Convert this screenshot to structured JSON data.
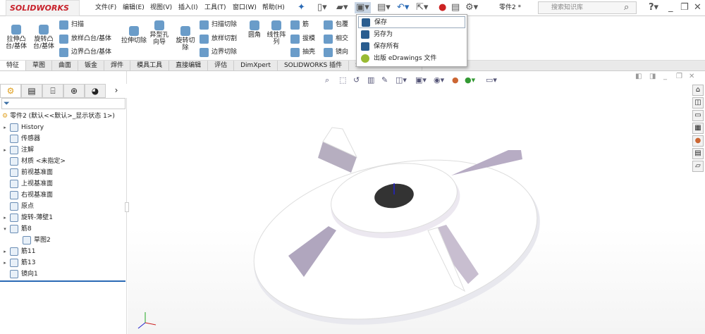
{
  "app": {
    "logo": "SOLIDWORKS",
    "document": "零件2 *",
    "search_placeholder": "搜索知识库"
  },
  "menu": [
    "文件(F)",
    "编辑(E)",
    "视图(V)",
    "插入(I)",
    "工具(T)",
    "窗口(W)",
    "帮助(H)"
  ],
  "ribbon": {
    "big": [
      "拉伸凸台/基体",
      "旋转凸台/基体",
      "拉伸切除",
      "异型孔向导",
      "旋转切除",
      "圆角",
      "线性阵列"
    ],
    "small": [
      "扫描",
      "放样凸台/基体",
      "边界凸台/基体",
      "扫描切除",
      "放样切割",
      "边界切除",
      "筋",
      "拔模",
      "抽壳",
      "包覆",
      "相交",
      "镜向"
    ]
  },
  "tabs": [
    "特征",
    "草图",
    "曲面",
    "钣金",
    "焊件",
    "模具工具",
    "直接编辑",
    "评估",
    "DimXpert",
    "SOLIDWORKS 插件",
    "SOLIDWORKS MBD"
  ],
  "save_menu": [
    "保存",
    "另存为",
    "保存所有",
    "出版 eDrawings 文件"
  ],
  "tree": {
    "root": "零件2  (默认<<默认>_显示状态 1>)",
    "items": [
      {
        "label": "History",
        "expand": "▸",
        "indent": 0
      },
      {
        "label": "传感器",
        "expand": "",
        "indent": 0
      },
      {
        "label": "注解",
        "expand": "▸",
        "indent": 0
      },
      {
        "label": "材质 <未指定>",
        "expand": "",
        "indent": 0
      },
      {
        "label": "前视基准面",
        "expand": "",
        "indent": 0
      },
      {
        "label": "上视基准面",
        "expand": "",
        "indent": 0
      },
      {
        "label": "右视基准面",
        "expand": "",
        "indent": 0
      },
      {
        "label": "原点",
        "expand": "",
        "indent": 0
      },
      {
        "label": "旋转-薄壁1",
        "expand": "▸",
        "indent": 0
      },
      {
        "label": "筋8",
        "expand": "▾",
        "indent": 0
      },
      {
        "label": "草图2",
        "expand": "",
        "indent": 1
      },
      {
        "label": "筋11",
        "expand": "▸",
        "indent": 0
      },
      {
        "label": "筋13",
        "expand": "▸",
        "indent": 0
      },
      {
        "label": "镜向1",
        "expand": "",
        "indent": 0
      }
    ]
  },
  "colors": {
    "accent": "#c8202a",
    "selection": "#2a5d8f"
  }
}
